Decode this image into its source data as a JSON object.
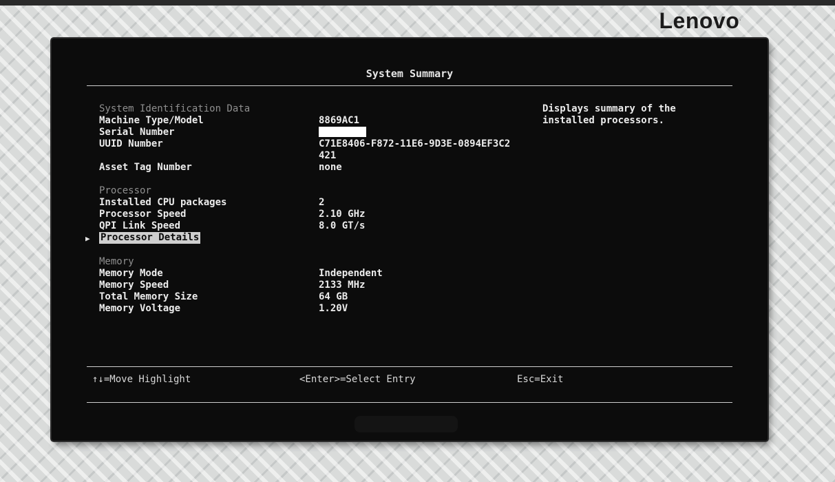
{
  "brand": {
    "logo": "Lenovo",
    "trademark": "."
  },
  "screen": {
    "title": "System Summary"
  },
  "help_text": [
    "Displays summary of the",
    "installed processors."
  ],
  "sections": {
    "identification": {
      "heading": "System Identification Data",
      "machine_type_label": "Machine Type/Model",
      "machine_type_value": "8869AC1",
      "serial_label": "Serial Number",
      "serial_value": "",
      "uuid_label": "UUID Number",
      "uuid_value_line1": "C71E8406-F872-11E6-9D3E-0894EF3C2",
      "uuid_value_line2": "421",
      "asset_tag_label": "Asset Tag Number",
      "asset_tag_value": "none"
    },
    "processor": {
      "heading": "Processor",
      "cpu_packages_label": "Installed CPU packages",
      "cpu_packages_value": "2",
      "speed_label": "Processor Speed",
      "speed_value": "2.10 GHz",
      "qpi_label": "QPI Link Speed",
      "qpi_value": "8.0 GT/s",
      "details_label": "Processor Details",
      "pointer_icon": "triangle-right-icon"
    },
    "memory": {
      "heading": "Memory",
      "mode_label": "Memory Mode",
      "mode_value": "Independent",
      "speed_label": "Memory Speed",
      "speed_value": "2133 MHz",
      "total_label": "Total Memory Size",
      "total_value": "64 GB",
      "voltage_label": "Memory Voltage",
      "voltage_value": "1.20V"
    }
  },
  "footer": {
    "move": "↑↓=Move Highlight",
    "select": "<Enter>=Select Entry",
    "exit": "Esc=Exit"
  },
  "colors": {
    "screen_bg": "#0c0c0c",
    "text": "#ececec",
    "heading_gray": "#8f8f8f",
    "highlight": "#cfcfcf"
  }
}
